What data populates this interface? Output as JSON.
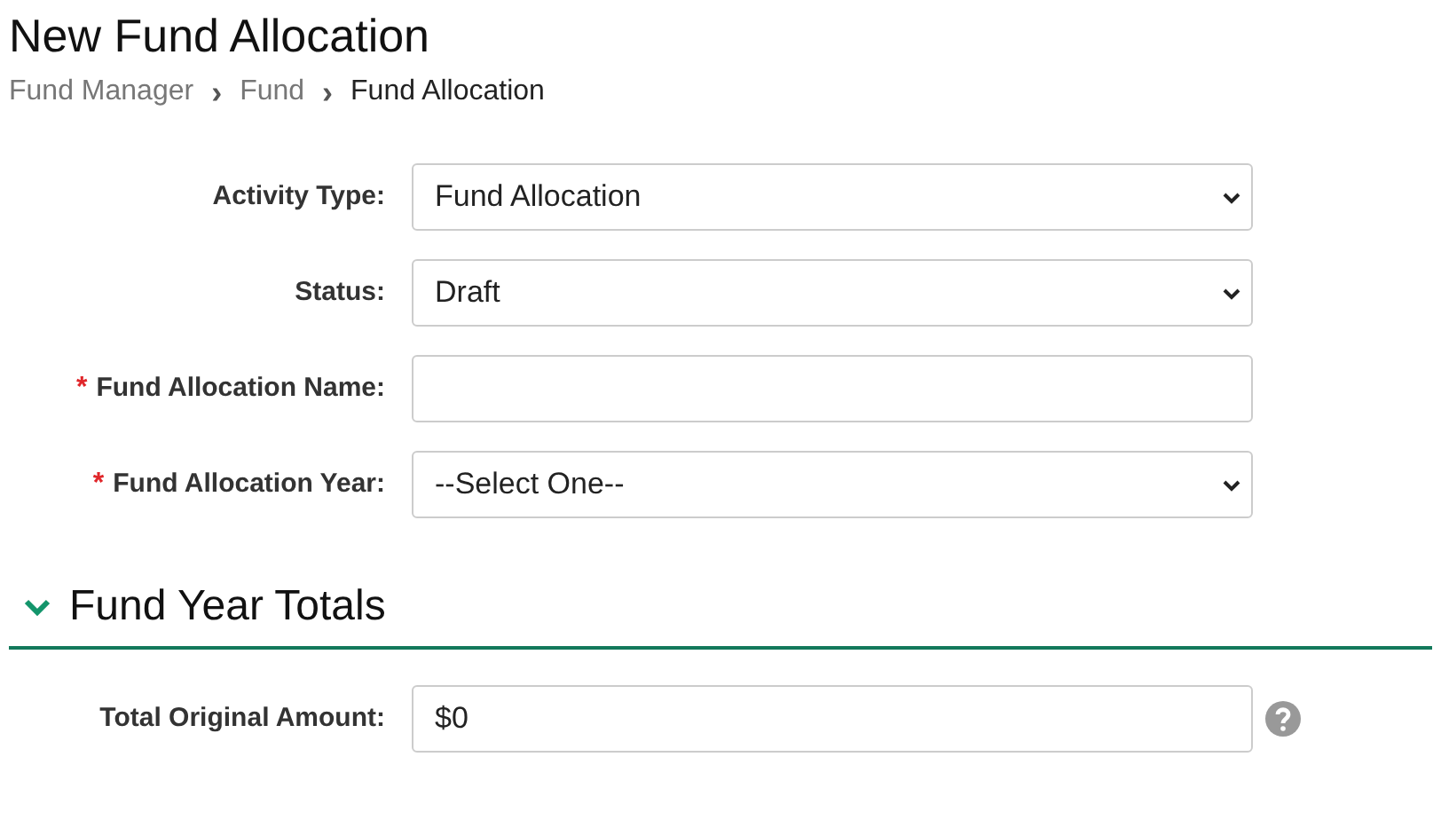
{
  "page_title": "New Fund Allocation",
  "breadcrumb": [
    {
      "label": "Fund Manager",
      "current": false
    },
    {
      "label": "Fund",
      "current": false
    },
    {
      "label": "Fund Allocation",
      "current": true
    }
  ],
  "separator": "›",
  "required_mark": "*",
  "fields": [
    {
      "label": "Activity Type:",
      "kind": "select",
      "value": "Fund Allocation",
      "required": false
    },
    {
      "label": "Status:",
      "kind": "select",
      "value": "Draft",
      "required": false
    },
    {
      "label": "Fund Allocation Name:",
      "kind": "text",
      "required": true
    },
    {
      "label": "Fund Allocation Year:",
      "kind": "select",
      "value": "--Select One--",
      "required": true
    }
  ],
  "section": {
    "title": "Fund Year Totals",
    "expanded": true,
    "fields": [
      {
        "label": "Total Original Amount:",
        "kind": "text",
        "value": "$0",
        "required": false,
        "help": true
      }
    ]
  }
}
